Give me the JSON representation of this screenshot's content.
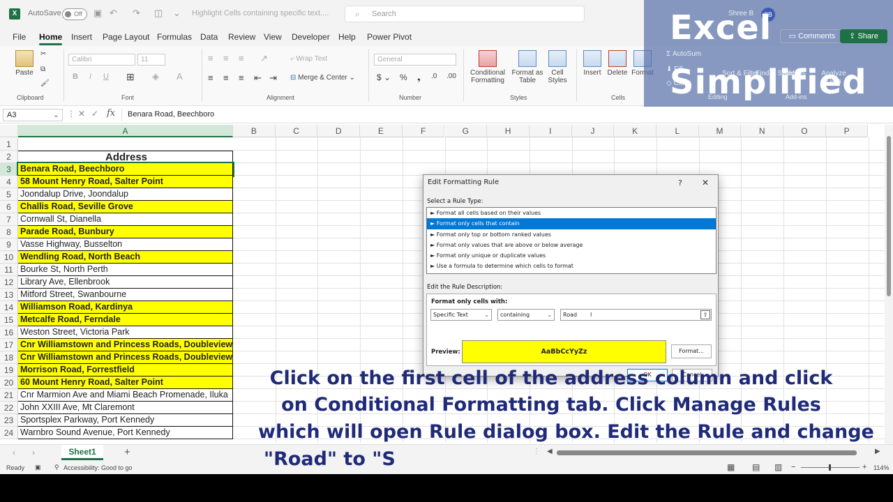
{
  "titlebar": {
    "autosave_label": "AutoSave",
    "autosave_state": "Off",
    "doc_title": "Highlight Cells containing specific text....",
    "search_placeholder": "Search",
    "user_initials": "SB",
    "user_name": "Shree B"
  },
  "menu": {
    "items": [
      "File",
      "Home",
      "Insert",
      "Page Layout",
      "Formulas",
      "Data",
      "Review",
      "View",
      "Developer",
      "Help",
      "Power Pivot"
    ],
    "active": "Home",
    "comments_label": "Comments",
    "share_label": "Share"
  },
  "ribbon": {
    "clipboard": {
      "paste": "Paste",
      "label": "Clipboard"
    },
    "font": {
      "name": "Calibri",
      "size": "11",
      "bold": "B",
      "italic": "I",
      "underline": "U",
      "label": "Font"
    },
    "alignment": {
      "wrap": "Wrap Text",
      "merge": "Merge & Center",
      "label": "Alignment"
    },
    "number": {
      "format": "General",
      "label": "Number"
    },
    "styles": {
      "conditional": "Conditional Formatting",
      "format_table": "Format as Table",
      "cell_styles": "Cell Styles",
      "label": "Styles"
    },
    "cells": {
      "insert": "Insert",
      "delete": "Delete",
      "format": "Format",
      "label": "Cells"
    },
    "editing": {
      "autosum": "AutoSum",
      "fill": "Fill",
      "clear": "Clear",
      "sort": "Sort & Filter",
      "find": "Find & Select",
      "label": "Editing"
    },
    "addins": {
      "addins": "Add-ins",
      "analyze": "Analyze Data",
      "label": "Add-ins"
    }
  },
  "formula_bar": {
    "name_box": "A3",
    "fx": "fx",
    "value": "Benara Road, Beechboro"
  },
  "columns": [
    "A",
    "B",
    "C",
    "D",
    "E",
    "F",
    "G",
    "H",
    "I",
    "J",
    "K",
    "L",
    "M",
    "N",
    "O",
    "P"
  ],
  "rows": [
    {
      "n": "1",
      "text": "",
      "highlight": false
    },
    {
      "n": "2",
      "text": "Address",
      "highlight": false,
      "header": true
    },
    {
      "n": "3",
      "text": "Benara Road, Beechboro",
      "highlight": true
    },
    {
      "n": "4",
      "text": "58 Mount Henry Road, Salter Point",
      "highlight": true
    },
    {
      "n": "5",
      "text": "Joondalup Drive, Joondalup",
      "highlight": false
    },
    {
      "n": "6",
      "text": "Challis Road, Seville Grove",
      "highlight": true
    },
    {
      "n": "7",
      "text": "Cornwall St, Dianella",
      "highlight": false
    },
    {
      "n": "8",
      "text": "Parade Road, Bunbury",
      "highlight": true
    },
    {
      "n": "9",
      "text": "Vasse Highway, Busselton",
      "highlight": false
    },
    {
      "n": "10",
      "text": "Wendling Road, North Beach",
      "highlight": true
    },
    {
      "n": "11",
      "text": "Bourke St, North Perth",
      "highlight": false
    },
    {
      "n": "12",
      "text": "Library Ave, Ellenbrook",
      "highlight": false
    },
    {
      "n": "13",
      "text": "Mitford Street, Swanbourne",
      "highlight": false
    },
    {
      "n": "14",
      "text": "Williamson Road, Kardinya",
      "highlight": true
    },
    {
      "n": "15",
      "text": "Metcalfe Road, Ferndale",
      "highlight": true
    },
    {
      "n": "16",
      "text": "Weston Street, Victoria Park",
      "highlight": false
    },
    {
      "n": "17",
      "text": "Cnr Williamstown and Princess Roads, Doubleview",
      "highlight": true
    },
    {
      "n": "18",
      "text": "Cnr Williamstown and Princess Roads, Doubleview",
      "highlight": true
    },
    {
      "n": "19",
      "text": "Morrison Road, Forrestfield",
      "highlight": true
    },
    {
      "n": "20",
      "text": "60 Mount Henry Road, Salter Point",
      "highlight": true
    },
    {
      "n": "21",
      "text": "Cnr Marmion Ave and Miami Beach Promenade, Iluka",
      "highlight": false
    },
    {
      "n": "22",
      "text": "John XXIII Ave, Mt Claremont",
      "highlight": false
    },
    {
      "n": "23",
      "text": "Sportsplex Parkway, Port Kennedy",
      "highlight": false
    },
    {
      "n": "24",
      "text": "Warnbro Sound Avenue, Port Kennedy",
      "highlight": false
    }
  ],
  "sheet": {
    "tab": "Sheet1",
    "add": "+"
  },
  "status": {
    "ready": "Ready",
    "accessibility": "Accessibility: Good to go",
    "zoom": "114%"
  },
  "dialog": {
    "title": "Edit Formatting Rule",
    "help": "?",
    "close": "✕",
    "select_rule_label": "Select a Rule Type:",
    "rule_types": [
      "► Format all cells based on their values",
      "► Format only cells that contain",
      "► Format only top or bottom ranked values",
      "► Format only values that are above or below average",
      "► Format only unique or duplicate values",
      "► Use a formula to determine which cells to format"
    ],
    "selected_index": 1,
    "edit_desc_label": "Edit the Rule Description:",
    "format_only_label": "Format only cells with:",
    "condition_type": "Specific Text",
    "operator": "containing",
    "value": "Road",
    "preview_label": "Preview:",
    "preview_text": "AaBbCcYyZz",
    "format_button": "Format...",
    "ok": "OK",
    "cancel": "Cancel"
  },
  "brand": {
    "line1": "Excel",
    "line2": "Simplified"
  },
  "caption": {
    "line1": "Click on the first cell of the address column and click",
    "line2": "on Conditional Formatting tab. Click Manage Rules",
    "line3": "which will open Rule dialog box. Edit the Rule and change",
    "line4": "\"Road\" to \"S"
  },
  "colors": {
    "excel_green": "#1e7145",
    "highlight": "#ffff00",
    "selected_rule": "#0078d7",
    "caption": "#1f2a78"
  }
}
